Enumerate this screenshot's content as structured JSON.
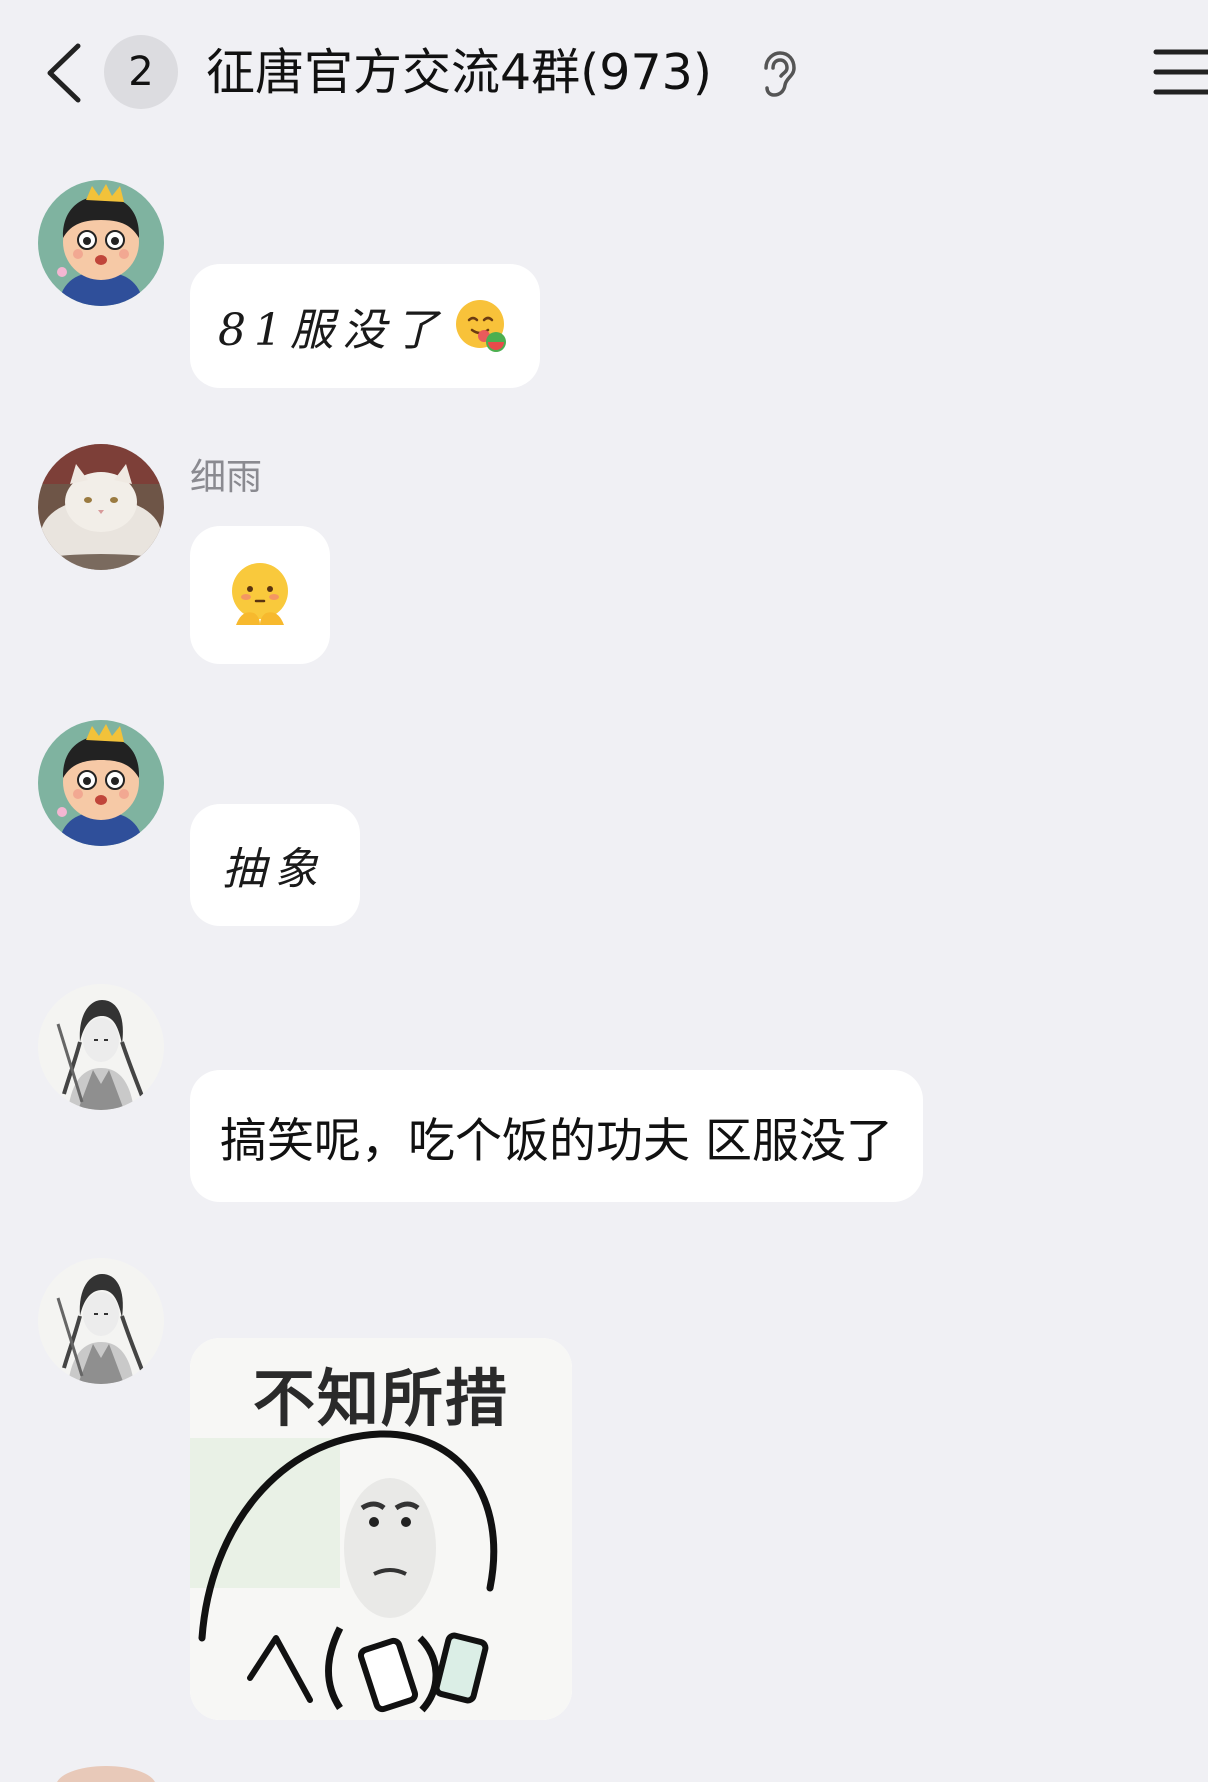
{
  "header": {
    "unread_count": "2",
    "group_title": "征唐官方交流4群(973)"
  },
  "messages": [
    {
      "sender": "",
      "avatar": "cartoon-boy-crown",
      "text": "81服没了",
      "emoji": "tongue-out-emoji"
    },
    {
      "sender": "细雨",
      "avatar": "white-cat",
      "emoji": "shy-face-emoji"
    },
    {
      "sender": "",
      "avatar": "cartoon-boy-crown",
      "text": "抽象"
    },
    {
      "sender": "",
      "avatar": "ink-swordsman",
      "text": "搞笑呢，吃个饭的功夫 区服没了"
    },
    {
      "sender": "",
      "avatar": "ink-swordsman",
      "sticker_caption": "不知所措"
    }
  ],
  "colors": {
    "background": "#f0f0f4",
    "bubble": "#ffffff",
    "badge": "#dcdce0",
    "sender_name": "#8a8a90"
  }
}
